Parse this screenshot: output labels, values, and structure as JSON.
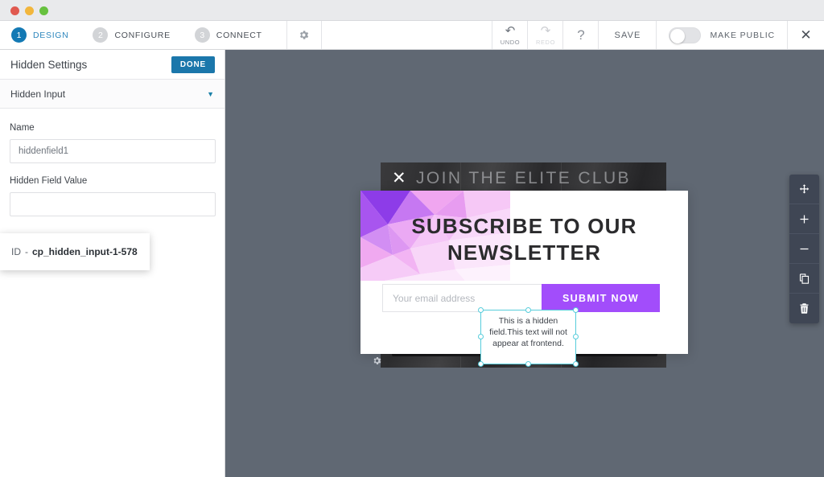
{
  "window": {
    "dots": [
      "close-red",
      "minimize-yellow",
      "maximize-green"
    ]
  },
  "topbar": {
    "steps": [
      {
        "num": "1",
        "label": "DESIGN",
        "active": true
      },
      {
        "num": "2",
        "label": "CONFIGURE",
        "active": false
      },
      {
        "num": "3",
        "label": "CONNECT",
        "active": false
      }
    ],
    "settings_icon": "gear-icon",
    "undo": {
      "label": "UNDO",
      "icon": "undo-arrow-icon",
      "enabled": true
    },
    "redo": {
      "label": "REDO",
      "icon": "redo-arrow-icon",
      "enabled": false
    },
    "help": {
      "label": "?",
      "icon": "question-mark-icon"
    },
    "save_label": "SAVE",
    "make_public_label": "MAKE PUBLIC",
    "make_public_state": "off",
    "close_label": "✕"
  },
  "sidebar": {
    "panel_title": "Hidden Settings",
    "done_label": "DONE",
    "accordion": {
      "label": "Hidden Input",
      "caret": "▼"
    },
    "fields": [
      {
        "label": "Name",
        "value": "hiddenfield1"
      },
      {
        "label": "Hidden Field Value",
        "value": "",
        "placeholder": ""
      }
    ],
    "field_name_label": "Name",
    "field_name_value": "hiddenfield1",
    "field_value_label": "Hidden Field Value",
    "field_value_value": ""
  },
  "id_popover": {
    "key": "ID",
    "dash": "-",
    "value": "cp_hidden_input-1-578"
  },
  "canvas": {
    "background_color": "#606873",
    "photo_popup": {
      "headline": "JOIN THE ELITE CLUB",
      "close_label": "✕",
      "gear_icon": "gear-icon"
    },
    "modal": {
      "title": "SUBSCRIBE TO OUR NEWSLETTER",
      "email_placeholder": "Your email address",
      "email_value": "",
      "submit_label": "SUBMIT NOW",
      "submit_color": "#a24dfb"
    },
    "selected_element": {
      "text": "This is a hidden field.This text will not appear at frontend.",
      "selection_color": "#57cddb"
    }
  },
  "right_tools": [
    {
      "name": "move-icon",
      "glyph": "move"
    },
    {
      "name": "plus-icon",
      "glyph": "plus"
    },
    {
      "name": "minus-icon",
      "glyph": "minus"
    },
    {
      "name": "duplicate-icon",
      "glyph": "duplicate"
    },
    {
      "name": "trash-icon",
      "glyph": "trash"
    }
  ]
}
